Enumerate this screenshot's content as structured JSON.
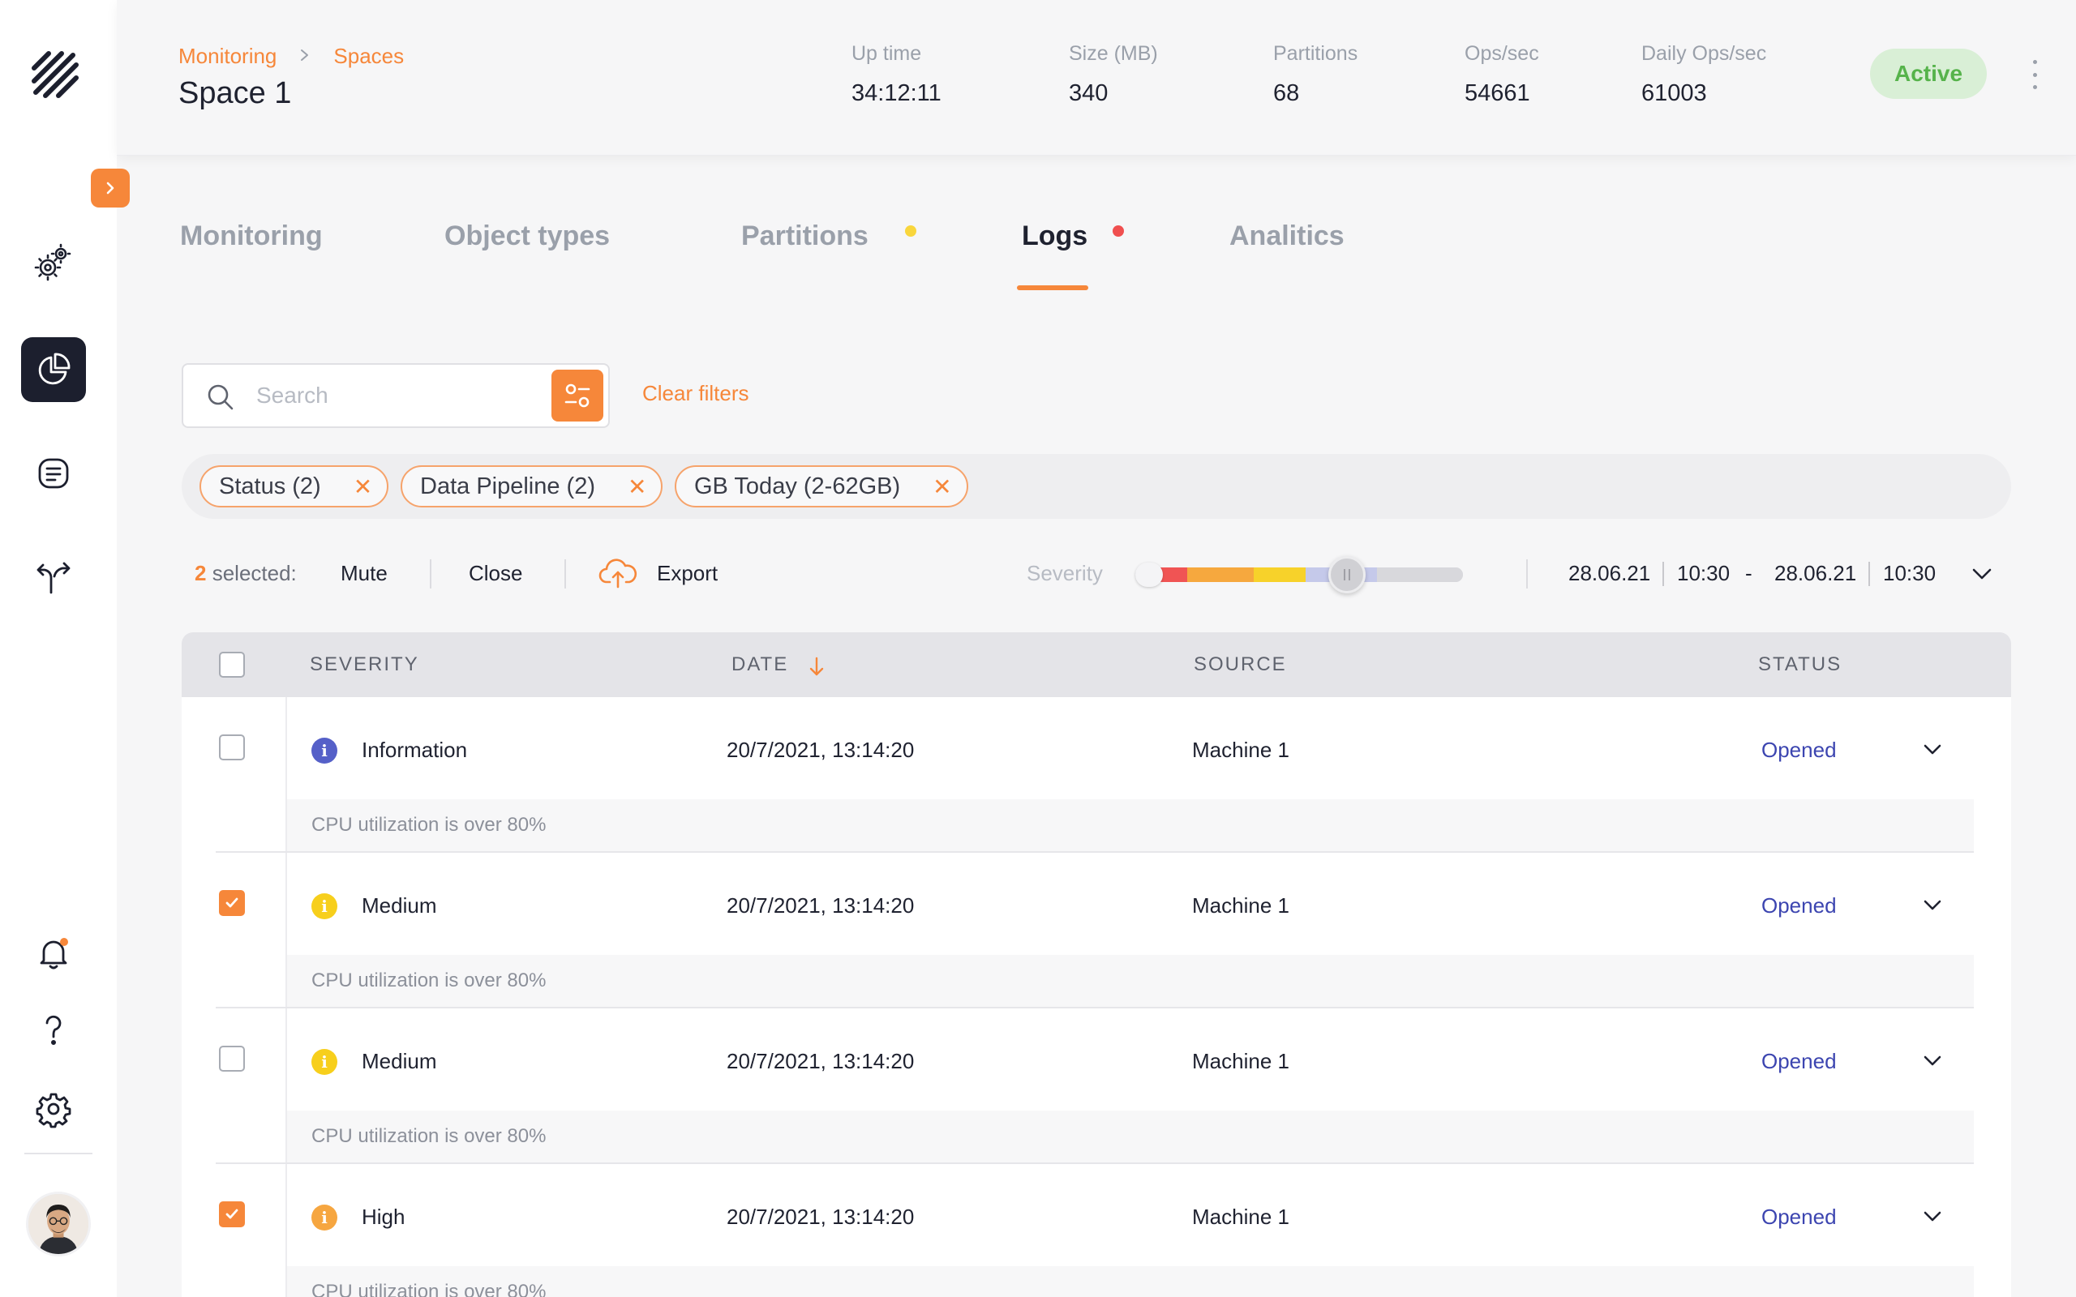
{
  "header": {
    "breadcrumb": [
      "Monitoring",
      "Spaces"
    ],
    "title": "Space 1",
    "stats": [
      {
        "label": "Up time",
        "value": "34:12:11"
      },
      {
        "label": "Size (MB)",
        "value": "340"
      },
      {
        "label": "Partitions",
        "value": "68"
      },
      {
        "label": "Ops/sec",
        "value": "54661"
      },
      {
        "label": "Daily Ops/sec",
        "value": "61003"
      }
    ],
    "status": "Active",
    "status_color": "#56b34b"
  },
  "sidebar": {
    "items": [
      "settings-gears-icon",
      "analytics-pie-icon",
      "logs-document-icon",
      "routes-icon"
    ],
    "bottom": [
      "notification-bell-icon",
      "help-icon",
      "settings-icon"
    ],
    "active": "analytics-pie-icon"
  },
  "tabs": [
    {
      "label": "Monitoring"
    },
    {
      "label": "Object types"
    },
    {
      "label": "Partitions",
      "dot": "#f9d63c"
    },
    {
      "label": "Logs",
      "dot": "#f04f4f",
      "active": true
    },
    {
      "label": "Analitics"
    }
  ],
  "search": {
    "placeholder": "Search",
    "clear_label": "Clear filters"
  },
  "chips": [
    {
      "label": "Status (2)"
    },
    {
      "label": "Data Pipeline (2)"
    },
    {
      "label": "GB Today (2-62GB)"
    }
  ],
  "actions": {
    "selected_count": "2",
    "selected_label": "selected:",
    "mute": "Mute",
    "close": "Close",
    "export": "Export",
    "severity_label": "Severity",
    "date_from": "28.06.21",
    "time_from": "10:30",
    "range_sep": "-",
    "date_to": "28.06.21",
    "time_to": "10:30"
  },
  "accent": "#f6873a",
  "table": {
    "headers": {
      "severity": "SEVERITY",
      "date": "DATE",
      "source": "SOURCE",
      "status": "STATUS"
    },
    "rows": [
      {
        "checked": false,
        "severity": "Information",
        "severity_color": "#5560c8",
        "date": "20/7/2021, 13:14:20",
        "source": "Machine 1",
        "status": "Opened",
        "message": "CPU utilization is over 80%"
      },
      {
        "checked": true,
        "severity": "Medium",
        "severity_color": "#f7cf1c",
        "date": "20/7/2021, 13:14:20",
        "source": "Machine 1",
        "status": "Opened",
        "message": "CPU utilization is over 80%"
      },
      {
        "checked": false,
        "severity": "Medium",
        "severity_color": "#f7cf1c",
        "date": "20/7/2021, 13:14:20",
        "source": "Machine 1",
        "status": "Opened",
        "message": "CPU utilization is over 80%"
      },
      {
        "checked": true,
        "severity": "High",
        "severity_color": "#f6a640",
        "date": "20/7/2021, 13:14:20",
        "source": "Machine 1",
        "status": "Opened",
        "message": "CPU utilization is over 80%"
      }
    ]
  }
}
